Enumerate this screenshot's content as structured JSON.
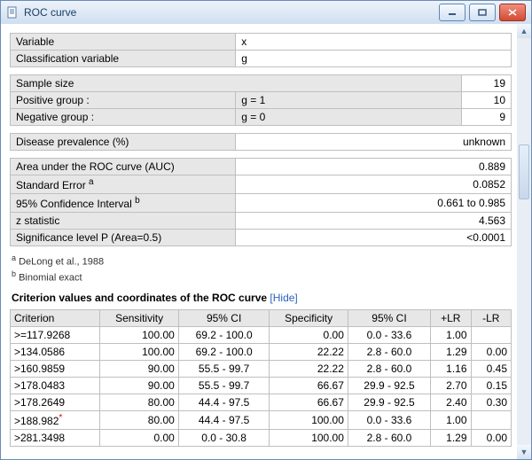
{
  "window": {
    "title": "ROC curve"
  },
  "vars": {
    "variable_label": "Variable",
    "variable_value": "x",
    "classvar_label": "Classification variable",
    "classvar_value": "g"
  },
  "sample": {
    "size_label": "Sample size",
    "size_value": "19",
    "pos_label": "Positive group :",
    "pos_cond": "g = 1",
    "pos_value": "10",
    "neg_label": "Negative group :",
    "neg_cond": "g = 0",
    "neg_value": "9"
  },
  "prevalence": {
    "label": "Disease prevalence (%)",
    "value": "unknown"
  },
  "roc": {
    "auc_label": "Area under the ROC curve (AUC)",
    "auc_value": "0.889",
    "se_label": "Standard Error",
    "se_sup": "a",
    "se_value": "0.0852",
    "ci_label": "95% Confidence Interval",
    "ci_sup": "b",
    "ci_value": "0.661 to 0.985",
    "z_label": "z statistic",
    "z_value": "4.563",
    "p_label": "Significance level P (Area=0.5)",
    "p_value": "<0.0001"
  },
  "footnotes": {
    "a": "DeLong et al., 1988",
    "b": "Binomial exact"
  },
  "criteria_section": {
    "title": "Criterion values and coordinates of the ROC curve",
    "hide": "[Hide]"
  },
  "criteria": {
    "headers": [
      "Criterion",
      "Sensitivity",
      "95% CI",
      "Specificity",
      "95% CI",
      "+LR",
      "-LR"
    ],
    "rows": [
      {
        "crit": ">=117.9268",
        "sens": "100.00",
        "sci": "69.2 - 100.0",
        "spec": "0.00",
        "pci": "0.0 - 33.6",
        "plr": "1.00",
        "mlr": ""
      },
      {
        "crit": ">134.0586",
        "sens": "100.00",
        "sci": "69.2 - 100.0",
        "spec": "22.22",
        "pci": "2.8 - 60.0",
        "plr": "1.29",
        "mlr": "0.00"
      },
      {
        "crit": ">160.9859",
        "sens": "90.00",
        "sci": "55.5 - 99.7",
        "spec": "22.22",
        "pci": "2.8 - 60.0",
        "plr": "1.16",
        "mlr": "0.45"
      },
      {
        "crit": ">178.0483",
        "sens": "90.00",
        "sci": "55.5 - 99.7",
        "spec": "66.67",
        "pci": "29.9 - 92.5",
        "plr": "2.70",
        "mlr": "0.15"
      },
      {
        "crit": ">178.2649",
        "sens": "80.00",
        "sci": "44.4 - 97.5",
        "spec": "66.67",
        "pci": "29.9 - 92.5",
        "plr": "2.40",
        "mlr": "0.30"
      },
      {
        "crit": ">188.982",
        "star": "*",
        "sens": "80.00",
        "sci": "44.4 - 97.5",
        "spec": "100.00",
        "pci": "0.0 - 33.6",
        "plr": "1.00",
        "mlr": ""
      },
      {
        "crit": ">281.3498",
        "sens": "0.00",
        "sci": "0.0 - 30.8",
        "spec": "100.00",
        "pci": "2.8 - 60.0",
        "plr": "1.29",
        "mlr": "0.00"
      }
    ]
  }
}
